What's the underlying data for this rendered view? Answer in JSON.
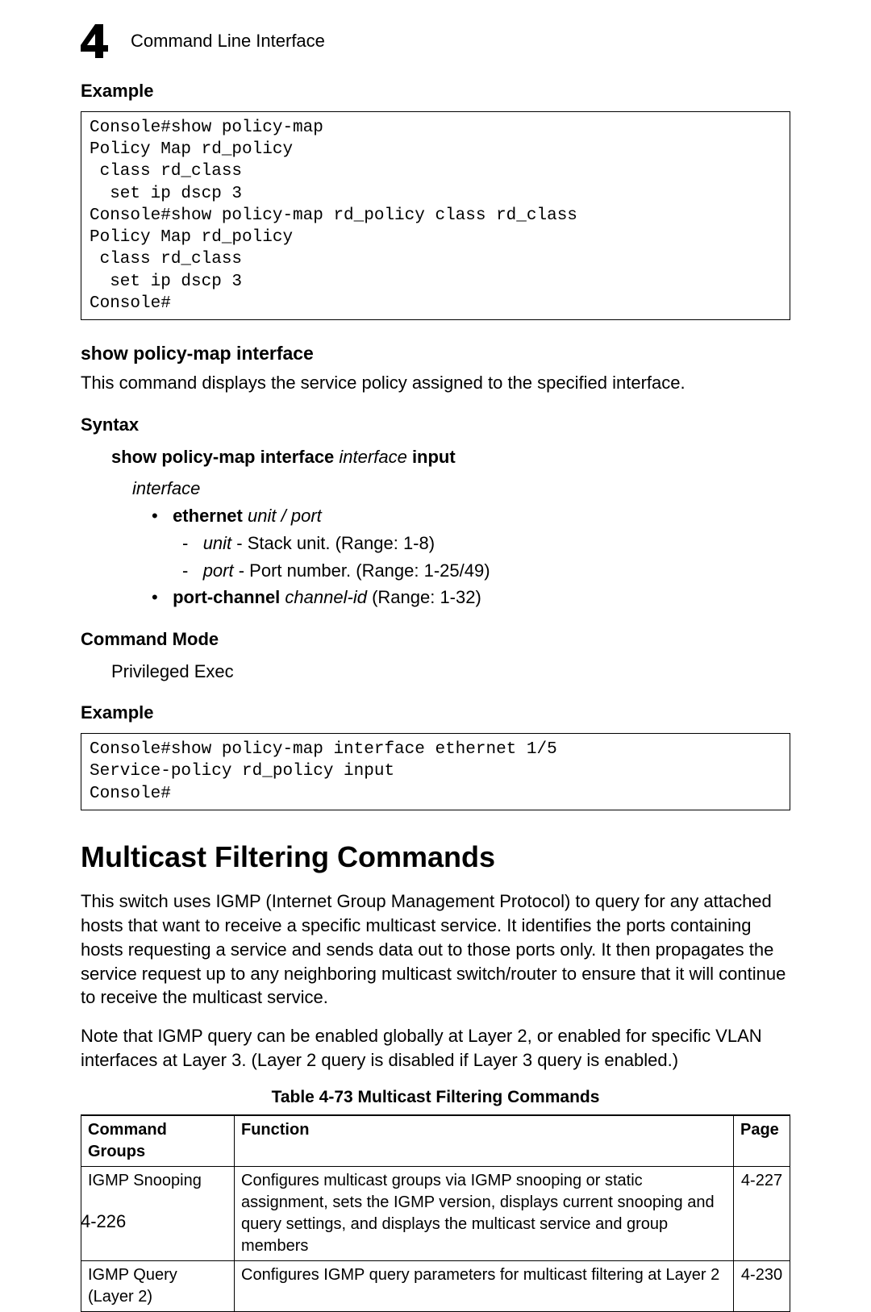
{
  "header": {
    "chapter_number": "4",
    "title": "Command Line Interface"
  },
  "section_example1": {
    "heading": "Example",
    "code": "Console#show policy-map\nPolicy Map rd_policy\n class rd_class\n  set ip dscp 3\nConsole#show policy-map rd_policy class rd_class\nPolicy Map rd_policy\n class rd_class\n  set ip dscp 3\nConsole#"
  },
  "cmd1": {
    "title": "show policy-map interface",
    "desc": "This command displays the service policy assigned to the specified interface.",
    "syntax_heading": "Syntax",
    "syntax_line_bold1": "show policy-map interface",
    "syntax_line_ital1": "interface",
    "syntax_line_bold2": "input",
    "interface_label": "interface",
    "ethernet_bold": "ethernet",
    "ethernet_ital": "unit",
    "slash": "/",
    "ethernet_ital2": "port",
    "unit_ital": "unit",
    "unit_text": " - Stack unit. (Range: 1-8)",
    "port_ital": "port",
    "port_text": " - Port number. (Range: 1-25/49)",
    "portchannel_bold": "port-channel",
    "portchannel_ital": "channel-id",
    "portchannel_text": " (Range: 1-32)",
    "mode_heading": "Command Mode",
    "mode_value": "Privileged Exec",
    "example_heading": "Example",
    "example_code": "Console#show policy-map interface ethernet 1/5\nService-policy rd_policy input\nConsole#"
  },
  "multicast": {
    "heading": "Multicast Filtering Commands",
    "para1": "This switch uses IGMP (Internet Group Management Protocol) to query for any attached hosts that want to receive a specific multicast service. It identifies the ports containing hosts requesting a service and sends data out to those ports only. It then propagates the service request up to any neighboring multicast switch/router to ensure that it will continue to receive the multicast service.",
    "para2": "Note that IGMP query can be enabled globally at Layer 2, or enabled for specific VLAN interfaces at Layer 3. (Layer 2 query is disabled if Layer 3 query is enabled.)",
    "table_caption": "Table 4-73   Multicast Filtering Commands",
    "table": {
      "headers": {
        "c1": "Command Groups",
        "c2": "Function",
        "c3": "Page"
      },
      "rows": [
        {
          "group": "IGMP Snooping",
          "func": "Configures multicast groups via IGMP snooping or static assignment, sets the IGMP version, displays current snooping and query settings, and displays the multicast service and group members",
          "page": "4-227"
        },
        {
          "group": "IGMP Query (Layer 2)",
          "func": "Configures IGMP query parameters for multicast filtering at Layer 2",
          "page": "4-230"
        }
      ]
    }
  },
  "page_number": "4-226"
}
